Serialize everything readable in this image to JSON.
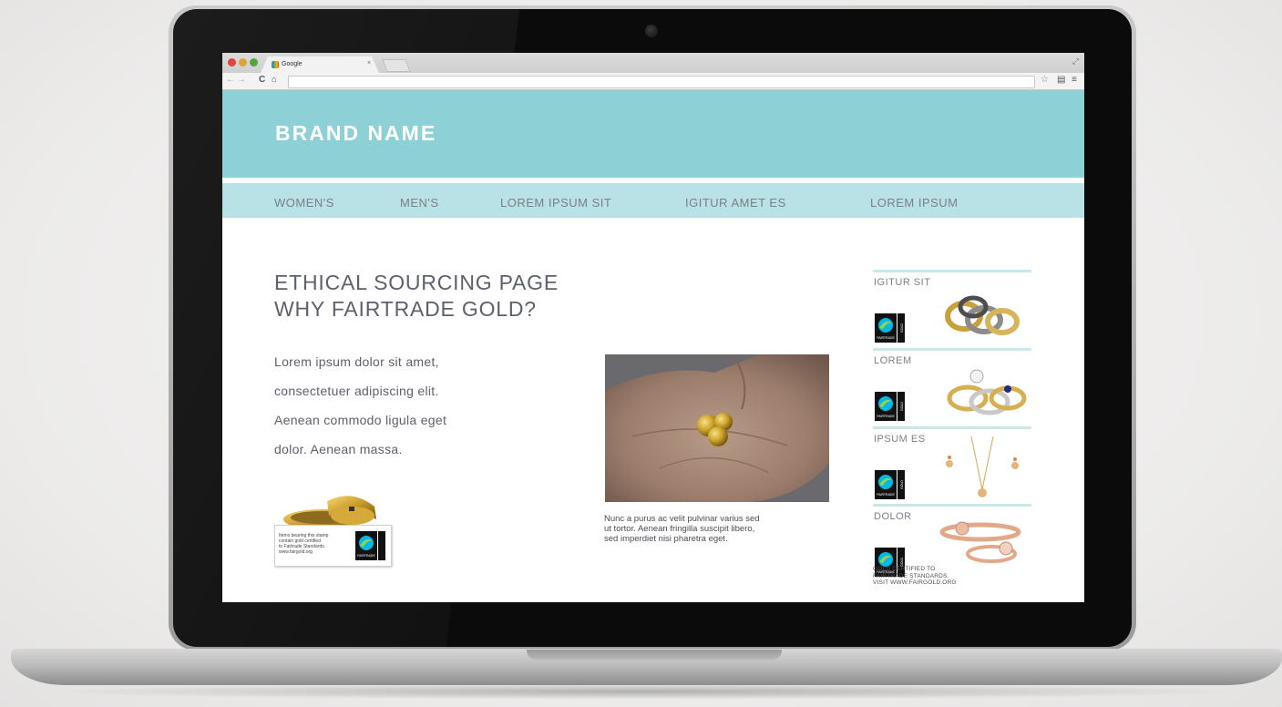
{
  "browser": {
    "tab_title": "Google",
    "tab_close": "×",
    "nav_back": "←",
    "nav_forward": "→",
    "nav_reload": "C",
    "nav_home": "⌂",
    "star": "☆",
    "menu": "≡"
  },
  "site": {
    "brand": "BRAND NAME",
    "nav": [
      "WOMEN'S",
      "MEN'S",
      "LOREM IPSUM SIT",
      "IGITUR AMET ES",
      "LOREM IPSUM"
    ],
    "page_title_line1": "ETHICAL SOURCING PAGE",
    "page_title_line2": "WHY FAIRTRADE GOLD?",
    "intro_lines": [
      "Lorem ipsum dolor sit amet,",
      "consectetuer adipiscing elit.",
      "Aenean commodo ligula eget",
      "dolor. Aenean massa."
    ],
    "stamp_text_lines": [
      "Items bearing this stamp",
      "contain gold certified",
      "to Fairtrade Standards.",
      "www.fairgold.org"
    ],
    "caption_lines": [
      "Nunc a purus ac velit pulvinar varius sed",
      "ut tortor. Aenean fringilla suscipit libero,",
      "sed imperdiet nisi pharetra eget."
    ],
    "sidebar": [
      {
        "label": "IGITUR SIT",
        "icon": "gold-rings-icon"
      },
      {
        "label": "LOREM",
        "icon": "diamond-rings-icon"
      },
      {
        "label": "IPSUM ES",
        "icon": "necklace-earrings-icon"
      },
      {
        "label": "DOLOR",
        "icon": "bangle-ring-icon"
      }
    ],
    "fairtrade_mark_text": "FAIRTRADE",
    "fairtrade_gold_text": "GOLD",
    "footnote_lines": [
      "GOLD CERTIFIED TO",
      "FAIRTRADE STANDARDS.",
      "VISIT WWW.FAIRGOLD.ORG"
    ]
  },
  "colors": {
    "header": "#8dd0d5",
    "nav": "#b8e2e5",
    "text": "#5d616d",
    "divider": "#c9e8ea"
  }
}
